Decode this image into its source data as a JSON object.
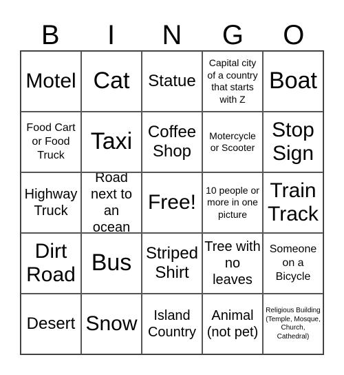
{
  "header": [
    "B",
    "I",
    "N",
    "G",
    "O"
  ],
  "cells": [
    {
      "text": "Motel",
      "size": "s-l"
    },
    {
      "text": "Cat",
      "size": "s-xl"
    },
    {
      "text": "Statue",
      "size": "s-m"
    },
    {
      "text": "Capital city of a country that starts with Z",
      "size": "s-xs"
    },
    {
      "text": "Boat",
      "size": "s-xl"
    },
    {
      "text": "Food Cart or Food Truck",
      "size": "s-s"
    },
    {
      "text": "Taxi",
      "size": "s-xl"
    },
    {
      "text": "Coffee Shop",
      "size": "s-m"
    },
    {
      "text": "Motercycle or Scooter",
      "size": "s-xs"
    },
    {
      "text": "Stop Sign",
      "size": "s-l"
    },
    {
      "text": "Highway Truck",
      "size": "s-ms"
    },
    {
      "text": "Road next to an ocean",
      "size": "s-ms"
    },
    {
      "text": "Free!",
      "size": "s-l"
    },
    {
      "text": "10 people or more in one picture",
      "size": "s-xs"
    },
    {
      "text": "Train Track",
      "size": "s-l"
    },
    {
      "text": "Dirt Road",
      "size": "s-l"
    },
    {
      "text": "Bus",
      "size": "s-xl"
    },
    {
      "text": "Striped Shirt",
      "size": "s-m"
    },
    {
      "text": "Tree with no leaves",
      "size": "s-ms"
    },
    {
      "text": "Someone on a Bicycle",
      "size": "s-s"
    },
    {
      "text": "Desert",
      "size": "s-m"
    },
    {
      "text": "Snow",
      "size": "s-l"
    },
    {
      "text": "Island Country",
      "size": "s-ms"
    },
    {
      "text": "Animal (not pet)",
      "size": "s-ms"
    },
    {
      "text": "Religious Building (Temple, Mosque, Church, Cathedral)",
      "size": "s-xxs"
    }
  ]
}
